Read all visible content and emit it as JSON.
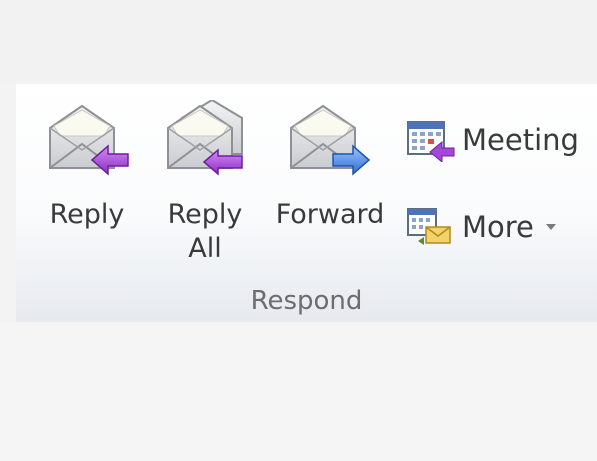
{
  "ribbon": {
    "group_label": "Respond",
    "buttons": {
      "reply": {
        "label": "Reply",
        "icon": "reply-envelope-icon"
      },
      "reply_all": {
        "label": "Reply\nAll",
        "icon": "reply-all-envelope-icon"
      },
      "forward": {
        "label": "Forward",
        "icon": "forward-envelope-icon"
      },
      "meeting": {
        "label": "Meeting",
        "icon": "meeting-calendar-icon"
      },
      "more": {
        "label": "More",
        "icon": "more-calendar-icon"
      }
    }
  },
  "colors": {
    "reply_arrow": "#9b3fcf",
    "forward_arrow": "#3d7fe0",
    "label_text": "#3a3a3a",
    "group_label_text": "#6d6d6d"
  }
}
